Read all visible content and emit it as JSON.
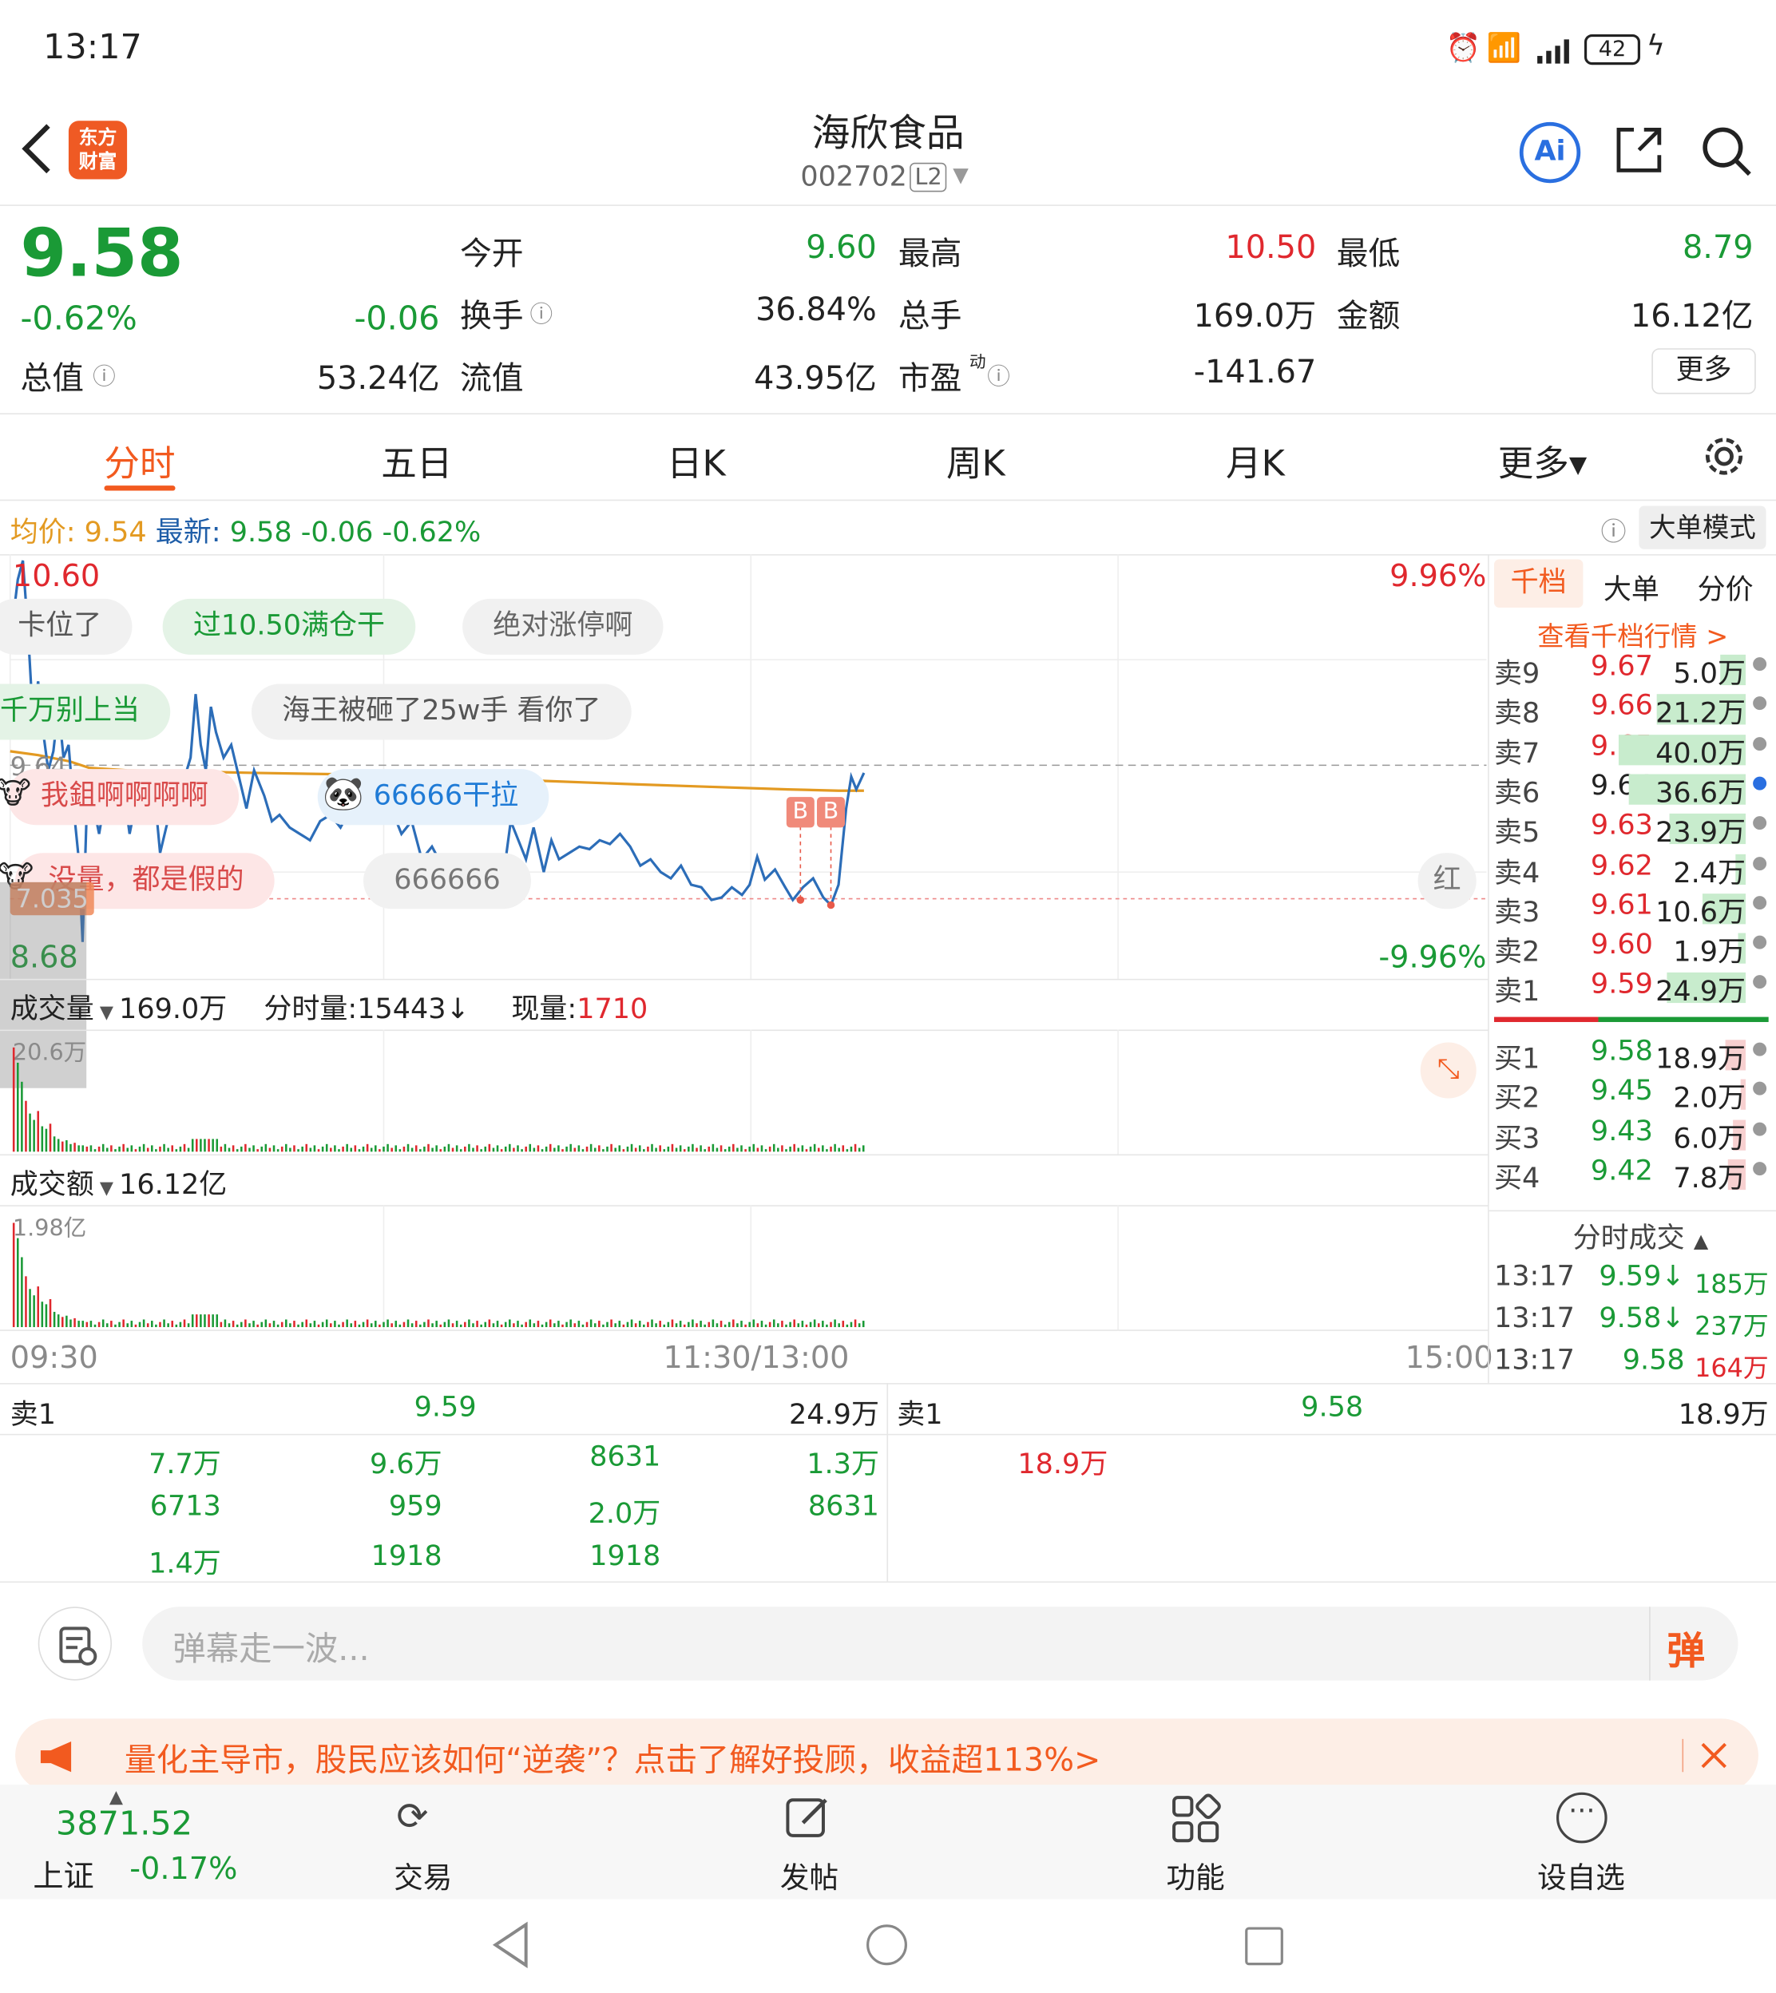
{
  "status": {
    "time": "13:17",
    "battery": "42"
  },
  "header": {
    "logo_line1": "东方",
    "logo_line2": "财富",
    "title": "海欣食品",
    "code": "002702",
    "level": "L2",
    "ai_label": "Ai"
  },
  "quote": {
    "price": "9.58",
    "change_pct": "-0.62%",
    "change": "-0.06",
    "open_label": "今开",
    "open": "9.60",
    "high_label": "最高",
    "high": "10.50",
    "low_label": "最低",
    "low": "8.79",
    "turnover_label": "换手",
    "turnover": "36.84%",
    "volume_label": "总手",
    "volume": "169.0万",
    "amount_label": "金额",
    "amount": "16.12亿",
    "mcap_label": "总值",
    "mcap": "53.24亿",
    "float_label": "流值",
    "float": "43.95亿",
    "pe_label": "市盈",
    "pe_sup": "动",
    "pe": "-141.67",
    "more": "更多"
  },
  "tabs": [
    {
      "label": "分时",
      "active": true
    },
    {
      "label": "五日"
    },
    {
      "label": "日K"
    },
    {
      "label": "周K"
    },
    {
      "label": "月K"
    },
    {
      "label": "更多▾"
    }
  ],
  "infobar": {
    "avg_label": "均价:",
    "avg": "9.54",
    "latest_label": "最新:",
    "latest": "9.58",
    "chg": "-0.06",
    "pct": "-0.62%",
    "mode": "大单模式"
  },
  "chart": {
    "y_high": "10.60",
    "y_low": "8.68",
    "pct_high": "9.96%",
    "pct_low": "-9.96%",
    "ref": "9.64",
    "cursor_label": "7.035",
    "markers": [
      "B",
      "B"
    ],
    "danmu": [
      "卡位了",
      "过10.50满仓干",
      "绝对涨停啊",
      "千万别上当",
      "海王被砸了25w手 看你了",
      "我鉏啊啊啊啊",
      "66666干拉",
      "没量，都是假的",
      "666666",
      "红"
    ]
  },
  "volume": {
    "label": "成交量",
    "total": "169.0万",
    "fs_label": "分时量:",
    "fs": "15443↓",
    "now_label": "现量:",
    "now": "1710",
    "max": "20.6万"
  },
  "amount": {
    "label": "成交额",
    "total": "16.12亿",
    "max": "1.98亿"
  },
  "time_axis": [
    "09:30",
    "11:30/13:00",
    "15:00"
  ],
  "orderbook": {
    "tabs": [
      "千档",
      "大单",
      "分价"
    ],
    "link": "查看千档行情 >",
    "asks": [
      [
        "卖9",
        "9.67",
        "5.0万"
      ],
      [
        "卖8",
        "9.66",
        "21.2万"
      ],
      [
        "卖7",
        "9.65",
        "40.0万"
      ],
      [
        "卖6",
        "9.64",
        "36.6万"
      ],
      [
        "卖5",
        "9.63",
        "23.9万"
      ],
      [
        "卖4",
        "9.62",
        "2.4万"
      ],
      [
        "卖3",
        "9.61",
        "10.6万"
      ],
      [
        "卖2",
        "9.60",
        "1.9万"
      ],
      [
        "卖1",
        "9.59",
        "24.9万"
      ]
    ],
    "bids": [
      [
        "买1",
        "9.58",
        "18.9万"
      ],
      [
        "买2",
        "9.45",
        "2.0万"
      ],
      [
        "买3",
        "9.43",
        "6.0万"
      ],
      [
        "买4",
        "9.42",
        "7.8万"
      ]
    ],
    "trades_label": "分时成交",
    "trades": [
      [
        "13:17",
        "9.59↓",
        "185万"
      ],
      [
        "13:17",
        "9.58↓",
        "237万"
      ],
      [
        "13:17",
        "9.58",
        "164万"
      ]
    ]
  },
  "queue": {
    "sell_label": "卖1",
    "sell_price": "9.59",
    "sell_vol": "24.9万",
    "buy_label": "卖1",
    "buy_price": "9.58",
    "buy_vol": "18.9万",
    "sell_rows": [
      [
        "7.7万",
        "9.6万",
        "8631",
        "1.3万"
      ],
      [
        "6713",
        "959",
        "2.0万",
        "8631"
      ],
      [
        "1.4万",
        "1918",
        "1918",
        ""
      ]
    ],
    "buy_rows": [
      [
        "18.9万"
      ]
    ]
  },
  "comment": {
    "placeholder": "弹幕走一波...",
    "send": "弹"
  },
  "banner": {
    "text": "量化主导市，股民应该如何“逆袭”？点击了解好投顾，收益超113%>"
  },
  "bottom": {
    "index_value": "3871.52",
    "index_name": "上证",
    "index_pct": "-0.17%",
    "items": [
      "交易",
      "发帖",
      "功能",
      "设自选"
    ]
  }
}
